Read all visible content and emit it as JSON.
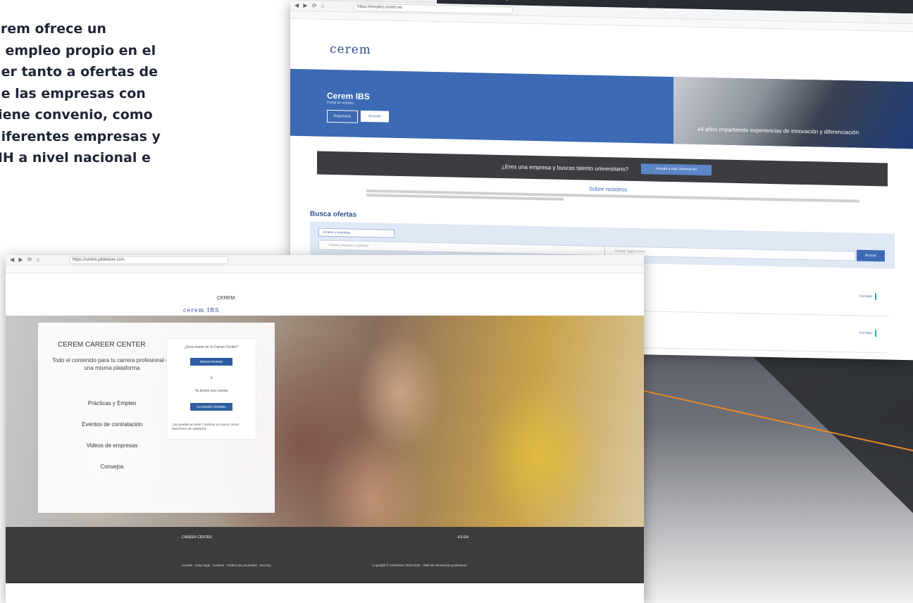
{
  "promo": {
    "lines": [
      "erem ofrece un",
      "e empleo propio en el",
      "der tanto a ofertas de",
      "de las empresas con",
      "tiene convenio, como",
      "diferentes empresas y",
      "HH a nivel nacional e"
    ]
  },
  "back_browser": {
    "url": "https://empleo.cerem.es",
    "logo": "cerem",
    "hero_title": "Cerem IBS",
    "hero_sub": "Portal de empleo",
    "register_label": "Registrarte",
    "access_label": "Acceder",
    "tagline": "44 años impartiendo experiencias de innovación y diferenciación",
    "company_question": "¿Eres una empresa y buscas talento universitario?",
    "company_button": "Accede a más información",
    "about_title": "Sobre nosotros",
    "busca_title": "Busca ofertas",
    "filter_label": "Empleo y prácticas",
    "search_placeholder": "Puesto, empresa o palabras",
    "location_placeholder": "Ciudad, región o país",
    "search_button": "Buscar",
    "offers": [
      {
        "apply": "Consejo"
      },
      {
        "apply": "Consejo"
      }
    ]
  },
  "front_browser": {
    "url": "https://cerem.jobteaser.com",
    "brand": "CEREM",
    "brand_logos": "cerem IBS",
    "title": "CEREM CAREER CENTER",
    "description": "Todo el contenido para tu carrera profesional en una misma plataforma",
    "menu": [
      "Prácticas y Empleo",
      "Eventos de contratación",
      "Videos de empresas",
      "Consejos"
    ],
    "login_question": "¿Eres nuevo en tu Career Center?",
    "register_button": "REGISTRARSE",
    "or": "o",
    "have_account": "Ya tienes una cuenta",
    "login_button": "ACCEDER CERMEL",
    "cannot_access": "¿No puedes acceder? Solicitar un nuevo correo electrónico de validación",
    "footer_logo": "CAREER CENTER",
    "footer_lang": "ES EN",
    "footer_links": "Grande   Aviso legal   Cookies   Política de privacidad   Security",
    "footer_copy": "Copyright © JobTeaser 2016-2021 · Web de orientación profesional"
  }
}
